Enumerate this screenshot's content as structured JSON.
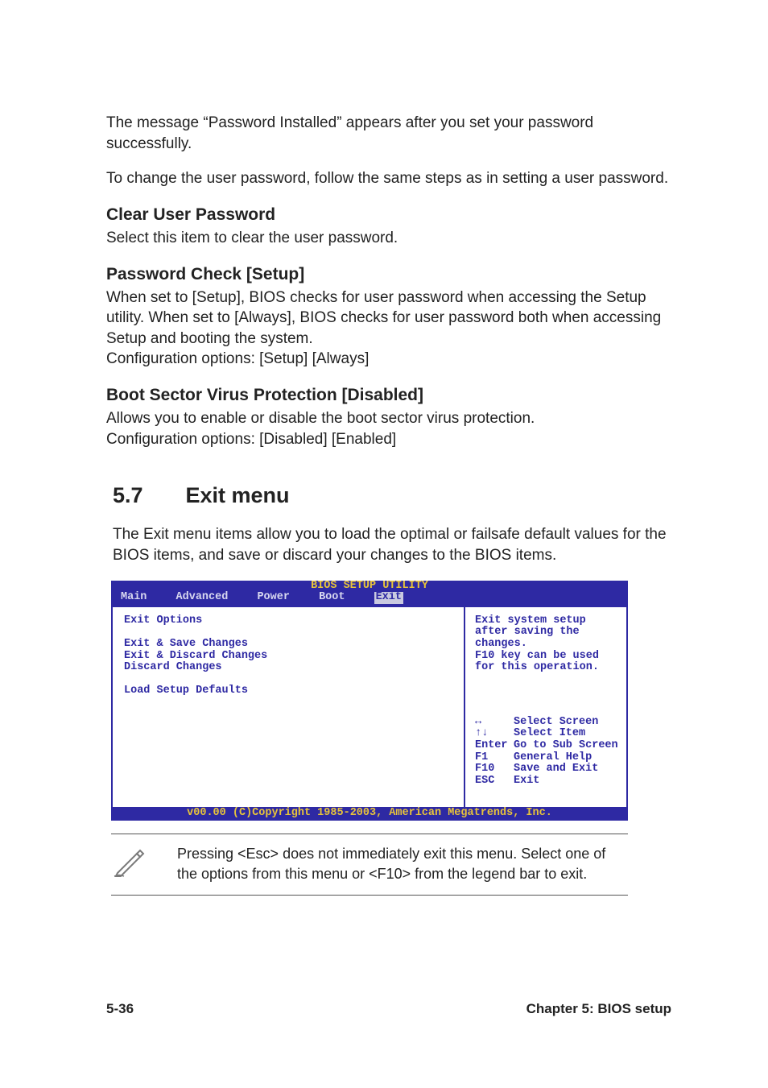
{
  "intro": {
    "p1": "The message “Password Installed” appears after you set your password successfully.",
    "p2": "To change the user password, follow the same steps as in setting a user password."
  },
  "sub1": {
    "title": "Clear User Password",
    "body": "Select this item to clear the user password."
  },
  "sub2": {
    "title": "Password Check [Setup]",
    "body1": "When set to [Setup], BIOS checks for user password when accessing the Setup utility. When set to [Always], BIOS checks for user password both when accessing Setup and booting the system.",
    "body2": "Configuration options: [Setup] [Always]"
  },
  "sub3": {
    "title": "Boot Sector Virus Protection [Disabled]",
    "body1": "Allows you to enable or disable the boot sector virus protection.",
    "body2": "Configuration options: [Disabled] [Enabled]"
  },
  "section": {
    "number": "5.7",
    "title": "Exit menu",
    "body": "The Exit menu items allow you to load the optimal or failsafe default values for the BIOS items, and save or discard your changes to the BIOS items."
  },
  "bios": {
    "title": "BIOS SETUP UTILITY",
    "tabs": [
      "Main",
      "Advanced",
      "Power",
      "Boot",
      "Exit"
    ],
    "active_tab": "Exit",
    "left": {
      "heading": "Exit Options",
      "items": [
        "Exit & Save Changes",
        "Exit & Discard Changes",
        "Discard Changes",
        "",
        "Load Setup Defaults"
      ]
    },
    "right": {
      "help": [
        "Exit system setup",
        "after saving the",
        "changes.",
        "F10 key can be used",
        "for this operation."
      ],
      "keys": [
        {
          "k": "↔",
          "d": "Select Screen"
        },
        {
          "k": "↑↓",
          "d": "Select Item"
        },
        {
          "k": "Enter",
          "d": "Go to Sub Screen"
        },
        {
          "k": "F1",
          "d": "General Help"
        },
        {
          "k": "F10",
          "d": "Save and Exit"
        },
        {
          "k": "ESC",
          "d": "Exit"
        }
      ]
    },
    "footer": "v00.00 (C)Copyright 1985-2003, American Megatrends, Inc."
  },
  "note": "Pressing <Esc> does not immediately exit this menu. Select one of the options from this menu or <F10> from the legend bar to exit.",
  "footer": {
    "left": "5-36",
    "right": "Chapter 5: BIOS setup"
  }
}
